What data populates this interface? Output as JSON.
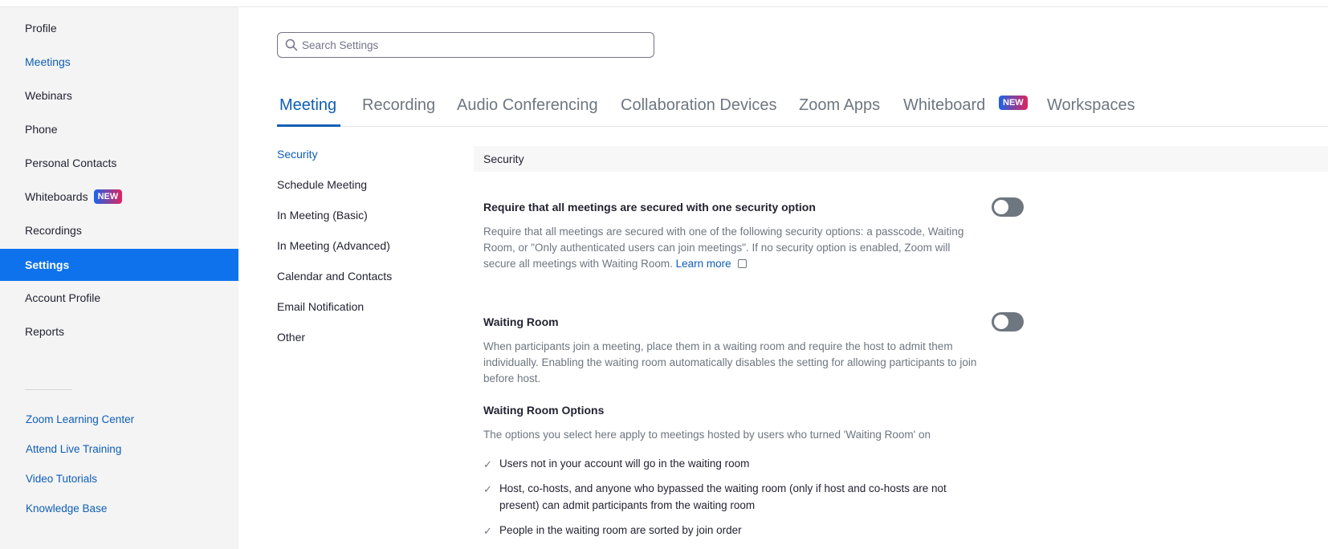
{
  "sidebar": {
    "items": [
      {
        "label": "Profile"
      },
      {
        "label": "Meetings"
      },
      {
        "label": "Webinars"
      },
      {
        "label": "Phone"
      },
      {
        "label": "Personal Contacts"
      },
      {
        "label": "Whiteboards",
        "badge": "NEW"
      },
      {
        "label": "Recordings"
      },
      {
        "label": "Settings"
      },
      {
        "label": "Account Profile"
      },
      {
        "label": "Reports"
      }
    ],
    "links": [
      {
        "label": "Zoom Learning Center"
      },
      {
        "label": "Attend Live Training"
      },
      {
        "label": "Video Tutorials"
      },
      {
        "label": "Knowledge Base"
      }
    ]
  },
  "search": {
    "placeholder": "Search Settings"
  },
  "tabs": [
    {
      "label": "Meeting"
    },
    {
      "label": "Recording"
    },
    {
      "label": "Audio Conferencing"
    },
    {
      "label": "Collaboration Devices"
    },
    {
      "label": "Zoom Apps"
    },
    {
      "label": "Whiteboard",
      "badge": "NEW"
    },
    {
      "label": "Workspaces"
    }
  ],
  "subnav": [
    {
      "label": "Security"
    },
    {
      "label": "Schedule Meeting"
    },
    {
      "label": "In Meeting (Basic)"
    },
    {
      "label": "In Meeting (Advanced)"
    },
    {
      "label": "Calendar and Contacts"
    },
    {
      "label": "Email Notification"
    },
    {
      "label": "Other"
    }
  ],
  "content": {
    "section_title": "Security",
    "settings": [
      {
        "title": "Require that all meetings are secured with one security option",
        "description": "Require that all meetings are secured with one of the following security options: a passcode, Waiting Room, or \"Only authenticated users can join meetings\". If no security option is enabled, Zoom will secure all meetings with Waiting Room.",
        "link": "Learn more",
        "enabled": false
      },
      {
        "title": "Waiting Room",
        "description": "When participants join a meeting, place them in a waiting room and require the host to admit them individually. Enabling the waiting room automatically disables the setting for allowing participants to join before host.",
        "enabled": false
      }
    ],
    "waiting_room_options": {
      "title": "Waiting Room Options",
      "description": "The options you select here apply to meetings hosted by users who turned 'Waiting Room' on",
      "items": [
        "Users not in your account will go in the waiting room",
        "Host, co-hosts, and anyone who bypassed the waiting room (only if host and co-hosts are not present) can admit participants from the waiting room",
        "People in the waiting room are sorted by join order"
      ]
    }
  },
  "colors": {
    "accent": "#0e72ed",
    "link": "#0e5eb5",
    "toggle_off": "#6e7680"
  }
}
